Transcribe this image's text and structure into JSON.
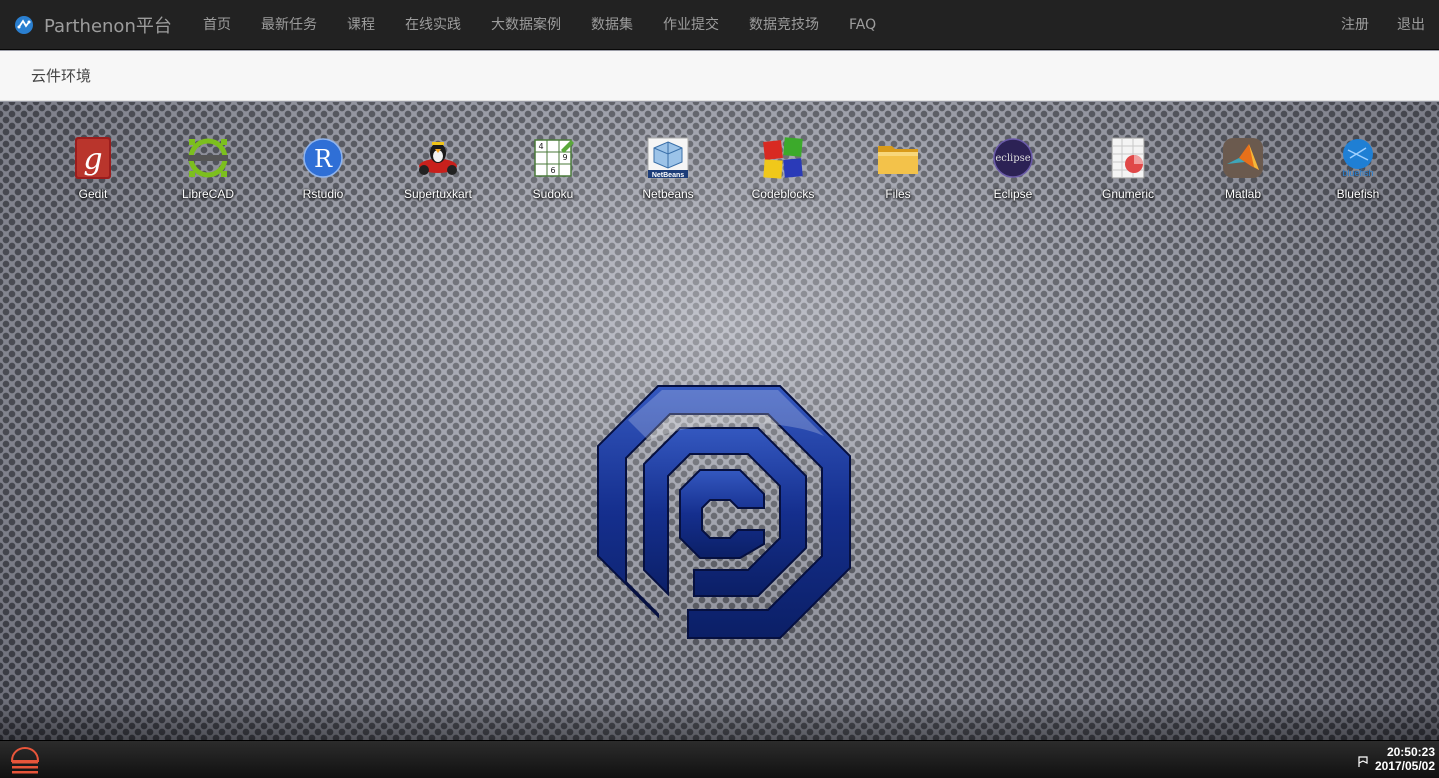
{
  "brand": {
    "name": "Parthenon平台"
  },
  "nav": {
    "items": [
      {
        "label": "首页"
      },
      {
        "label": "最新任务"
      },
      {
        "label": "课程"
      },
      {
        "label": "在线实践"
      },
      {
        "label": "大数据案例"
      },
      {
        "label": "数据集"
      },
      {
        "label": "作业提交"
      },
      {
        "label": "数据竞技场"
      },
      {
        "label": "FAQ"
      }
    ],
    "right": [
      {
        "label": "注册"
      },
      {
        "label": "退出"
      }
    ]
  },
  "breadcrumb": {
    "title": "云件环境"
  },
  "desktop": {
    "apps": [
      {
        "label": "Gedit",
        "icon": "gedit-icon"
      },
      {
        "label": "LibreCAD",
        "icon": "librecad-icon"
      },
      {
        "label": "Rstudio",
        "icon": "rstudio-icon"
      },
      {
        "label": "Supertuxkart",
        "icon": "supertuxkart-icon"
      },
      {
        "label": "Sudoku",
        "icon": "sudoku-icon"
      },
      {
        "label": "Netbeans",
        "icon": "netbeans-icon"
      },
      {
        "label": "Codeblocks",
        "icon": "codeblocks-icon"
      },
      {
        "label": "Files",
        "icon": "folder-icon"
      },
      {
        "label": "Eclipse",
        "icon": "eclipse-icon"
      },
      {
        "label": "Gnumeric",
        "icon": "gnumeric-icon"
      },
      {
        "label": "Matlab",
        "icon": "matlab-icon"
      },
      {
        "label": "Bluefish",
        "icon": "bluefish-icon"
      }
    ],
    "wallpaper_logo": "octagon-logo",
    "icon_text": {
      "rstudio": "R",
      "netbeans": "NetBeans",
      "eclipse": "eclipse",
      "bluefish": "bluefish",
      "sudoku": [
        "4",
        "9",
        "6"
      ]
    }
  },
  "taskbar": {
    "clock_time": "20:50:23",
    "clock_date": "2017/05/02"
  },
  "colors": {
    "navbar": "#222222",
    "nav_text": "#9d9d9d",
    "subbar": "#f7f7f7",
    "logo_blue": "#1a3a9a",
    "start_orange": "#e8553a"
  }
}
